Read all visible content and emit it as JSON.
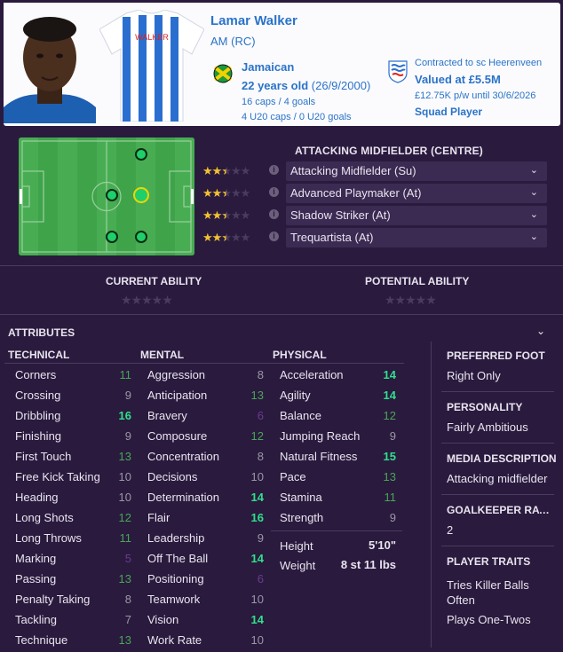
{
  "player": {
    "name": "Lamar Walker",
    "position": "AM (RC)",
    "shirt_name": "WALKER",
    "nationality": "Jamaican",
    "age_label": "22 years old",
    "dob": "(26/9/2000)",
    "caps": "16 caps / 4 goals",
    "u20_caps": "4 U20 caps / 0 U20 goals"
  },
  "contract": {
    "club_line": "Contracted to sc Heerenveen",
    "value": "Valued at £5.5M",
    "wage": "£12.75K p/w until 30/6/2026",
    "status": "Squad Player"
  },
  "roles": {
    "title": "ATTACKING MIDFIELDER (CENTRE)",
    "items": [
      {
        "label": "Attacking Midfielder (Su)",
        "stars": 2.5
      },
      {
        "label": "Advanced Playmaker (At)",
        "stars": 2.5
      },
      {
        "label": "Shadow Striker (At)",
        "stars": 2.5
      },
      {
        "label": "Trequartista (At)",
        "stars": 2.5
      }
    ]
  },
  "ability": {
    "current_label": "CURRENT ABILITY",
    "potential_label": "POTENTIAL ABILITY"
  },
  "attributes": {
    "title": "ATTRIBUTES",
    "technical_title": "TECHNICAL",
    "mental_title": "MENTAL",
    "physical_title": "PHYSICAL",
    "technical": [
      {
        "name": "Corners",
        "value": "11"
      },
      {
        "name": "Crossing",
        "value": "9"
      },
      {
        "name": "Dribbling",
        "value": "16"
      },
      {
        "name": "Finishing",
        "value": "9"
      },
      {
        "name": "First Touch",
        "value": "13"
      },
      {
        "name": "Free Kick Taking",
        "value": "10"
      },
      {
        "name": "Heading",
        "value": "10"
      },
      {
        "name": "Long Shots",
        "value": "12"
      },
      {
        "name": "Long Throws",
        "value": "11"
      },
      {
        "name": "Marking",
        "value": "5"
      },
      {
        "name": "Passing",
        "value": "13"
      },
      {
        "name": "Penalty Taking",
        "value": "8"
      },
      {
        "name": "Tackling",
        "value": "7"
      },
      {
        "name": "Technique",
        "value": "13"
      }
    ],
    "mental": [
      {
        "name": "Aggression",
        "value": "8"
      },
      {
        "name": "Anticipation",
        "value": "13"
      },
      {
        "name": "Bravery",
        "value": "6"
      },
      {
        "name": "Composure",
        "value": "12"
      },
      {
        "name": "Concentration",
        "value": "8"
      },
      {
        "name": "Decisions",
        "value": "10"
      },
      {
        "name": "Determination",
        "value": "14"
      },
      {
        "name": "Flair",
        "value": "16"
      },
      {
        "name": "Leadership",
        "value": "9"
      },
      {
        "name": "Off The Ball",
        "value": "14"
      },
      {
        "name": "Positioning",
        "value": "6"
      },
      {
        "name": "Teamwork",
        "value": "10"
      },
      {
        "name": "Vision",
        "value": "14"
      },
      {
        "name": "Work Rate",
        "value": "10"
      }
    ],
    "physical": [
      {
        "name": "Acceleration",
        "value": "14"
      },
      {
        "name": "Agility",
        "value": "14"
      },
      {
        "name": "Balance",
        "value": "12"
      },
      {
        "name": "Jumping Reach",
        "value": "9"
      },
      {
        "name": "Natural Fitness",
        "value": "15"
      },
      {
        "name": "Pace",
        "value": "13"
      },
      {
        "name": "Stamina",
        "value": "11"
      },
      {
        "name": "Strength",
        "value": "9"
      }
    ],
    "height_label": "Height",
    "height_value": "5'10\"",
    "weight_label": "Weight",
    "weight_value": "8 st 11 lbs"
  },
  "side": {
    "preferred_foot_title": "PREFERRED FOOT",
    "preferred_foot": "Right Only",
    "personality_title": "PERSONALITY",
    "personality": "Fairly Ambitious",
    "media_title": "MEDIA DESCRIPTION",
    "media": "Attacking midfielder",
    "gk_title": "GOALKEEPER RATING",
    "gk_value": "2",
    "traits_title": "PLAYER TRAITS",
    "traits": [
      "Tries Killer Balls Often",
      "Plays One-Twos"
    ]
  },
  "colors": {
    "background": "#2a1a3e",
    "accent_blue": "#2a73c9",
    "high": "#2fe08a",
    "good": "#47a755",
    "low": "#6a3c8e",
    "star": "#f2c230"
  }
}
